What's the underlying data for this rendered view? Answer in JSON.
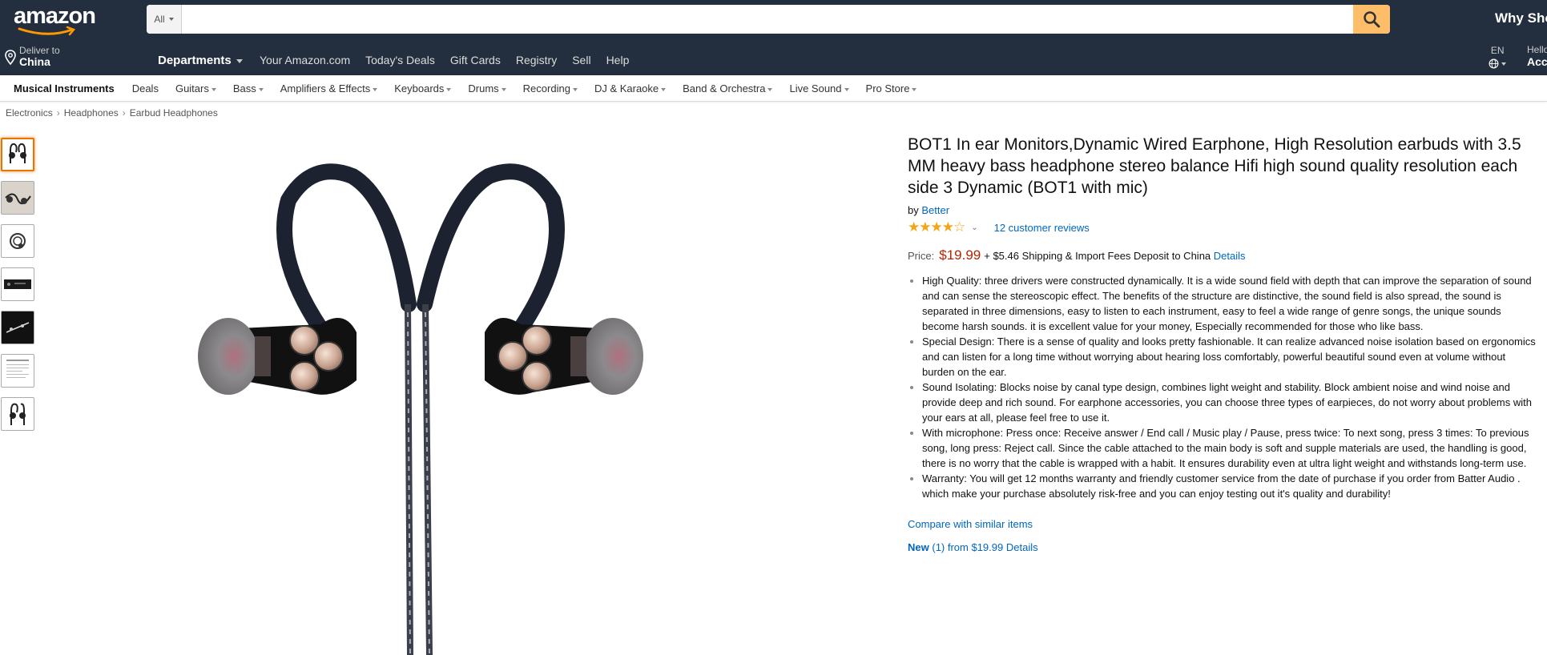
{
  "header": {
    "logo_text": "amazon",
    "search": {
      "category": "All",
      "placeholder": "",
      "value": ""
    },
    "promo_text": "Why Shop",
    "deliver": {
      "line1": "Deliver to",
      "line2": "China"
    },
    "departments_label": "Departments",
    "nav_links": [
      "Your Amazon.com",
      "Today's Deals",
      "Gift Cards",
      "Registry",
      "Sell",
      "Help"
    ],
    "language": "EN",
    "account": {
      "line1": "Hello",
      "line2": "Acc"
    }
  },
  "subnav": {
    "items": [
      "Musical Instruments",
      "Deals",
      "Guitars",
      "Bass",
      "Amplifiers & Effects",
      "Keyboards",
      "Drums",
      "Recording",
      "DJ & Karaoke",
      "Band & Orchestra",
      "Live Sound",
      "Pro Store"
    ]
  },
  "breadcrumb": [
    "Electronics",
    "Headphones",
    "Earbud Headphones"
  ],
  "thumbnails": [
    "thumb-1",
    "thumb-2",
    "thumb-3",
    "thumb-4",
    "thumb-5",
    "thumb-6",
    "thumb-7"
  ],
  "product": {
    "title": "BOT1 In ear Monitors,Dynamic Wired Earphone, High Resolution earbuds with 3.5 MM heavy bass headphone stereo balance Hifi high sound quality resolution each side 3 Dynamic (BOT1 with mic)",
    "by_label": "by",
    "brand": "Better",
    "stars": "★★★★☆",
    "rating_value": 4,
    "reviews": "12 customer reviews",
    "price_label": "Price:",
    "price": "$19.99",
    "shipping": "+ $5.46 Shipping & Import Fees Deposit to China",
    "details_link": "Details",
    "bullets": [
      "High Quality: three drivers were constructed dynamically. It is a wide sound field with depth that can improve the separation of sound and can sense the stereoscopic effect. The benefits of the structure are distinctive, the sound field is also spread, the sound is separated in three dimensions, easy to listen to each instrument, easy to feel a wide range of genre songs, the unique sounds become harsh sounds. it is excellent value for your money, Especially recommended for those who like bass.",
      "Special Design: There is a sense of quality and looks pretty fashionable. It can realize advanced noise isolation based on ergonomics and can listen for a long time without worrying about hearing loss comfortably, powerful beautiful sound even at volume without burden on the ear.",
      "Sound Isolating: Blocks noise by canal type design, combines light weight and stability. Block ambient noise and wind noise and provide deep and rich sound. For earphone accessories, you can choose three types of earpieces, do not worry about problems with your ears at all, please feel free to use it.",
      "With microphone: Press once: Receive answer / End call / Music play / Pause, press twice: To next song, press 3 times: To previous song, long press: Reject call. Since the cable attached to the main body is soft and supple materials are used, the handling is good, there is no worry that the cable is wrapped with a habit. It ensures durability even at ultra light weight and withstands long-term use.",
      "Warranty: You will get 12 months warranty and friendly customer service from the date of purchase if you order from Batter Audio . which make your purchase absolutely risk-free and you can enjoy testing out it's quality and durability!"
    ],
    "compare_link": "Compare with similar items",
    "new_offer": {
      "label": "New",
      "text": "(1) from $19.99",
      "details": "Details"
    }
  },
  "colors": {
    "header_bg": "#232f3e",
    "search_button": "#febd69",
    "price": "#b12704",
    "link": "#0066c0",
    "star": "#f4a418",
    "selected_thumb": "#e77600"
  }
}
